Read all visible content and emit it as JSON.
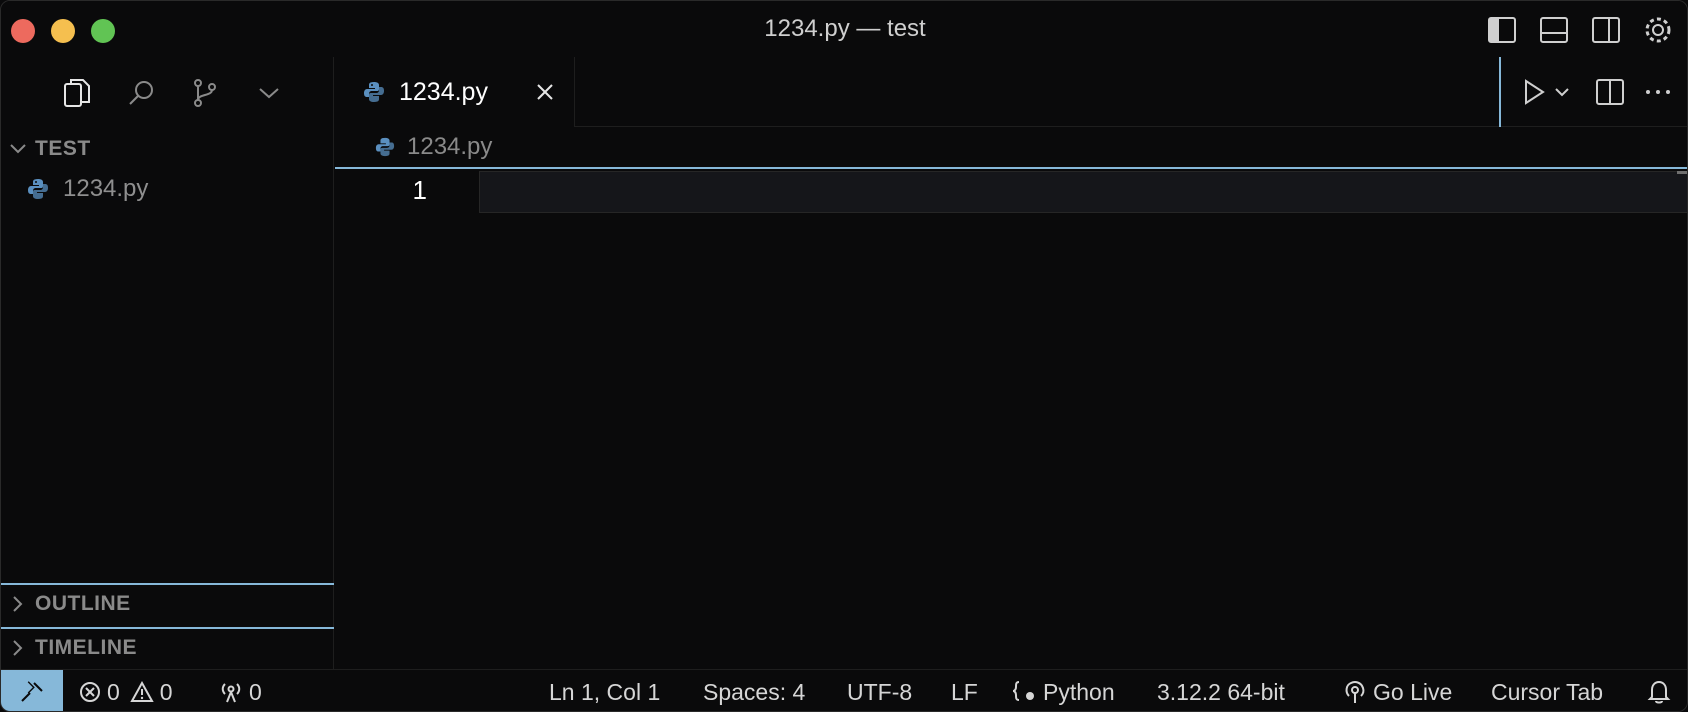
{
  "window": {
    "title": "1234.py — test"
  },
  "explorer": {
    "section_title": "TEST",
    "files": [
      {
        "name": "1234.py",
        "icon": "python-icon"
      }
    ],
    "outline_title": "OUTLINE",
    "timeline_title": "TIMELINE"
  },
  "editor": {
    "tab_label": "1234.py",
    "breadcrumb": "1234.py",
    "line_numbers": [
      "1"
    ]
  },
  "statusbar": {
    "errors": "0",
    "warnings": "0",
    "ports": "0",
    "position": "Ln 1, Col 1",
    "spaces": "Spaces: 4",
    "encoding": "UTF-8",
    "eol": "LF",
    "language": "Python",
    "interpreter": "3.12.2 64-bit",
    "go_live": "Go Live",
    "cursor_tab": "Cursor Tab"
  },
  "colors": {
    "accent": "#86b8d9",
    "python_blue": "#5a8fbf",
    "python_yellow": "#e7c86a"
  }
}
